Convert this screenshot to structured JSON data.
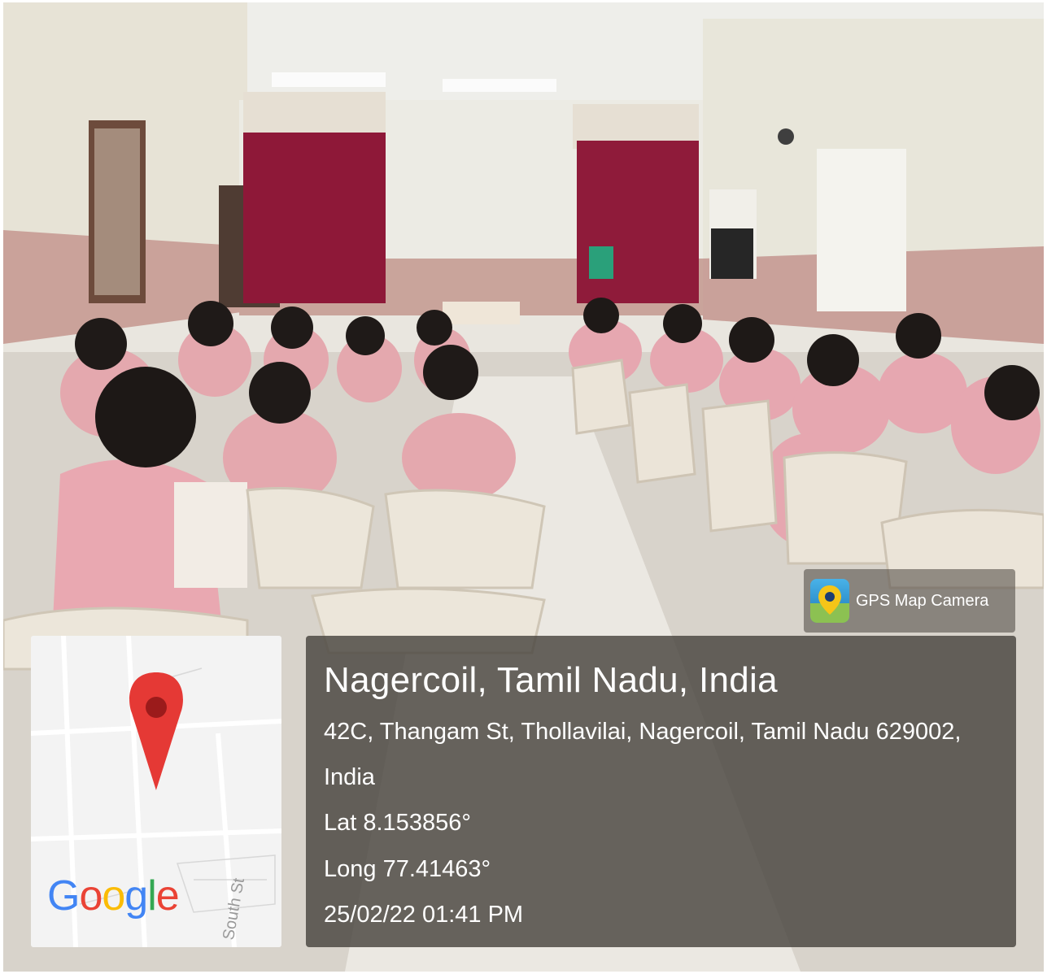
{
  "badge": {
    "icon": "gps-map-camera-app-icon",
    "label": "GPS Map Camera"
  },
  "map": {
    "logo_letters": [
      "G",
      "o",
      "o",
      "g",
      "l",
      "e"
    ],
    "logo_colors": [
      "#4285F4",
      "#EA4335",
      "#FBBC05",
      "#4285F4",
      "#34A853",
      "#EA4335"
    ],
    "street_label": "South St",
    "pin_color": "#E53935"
  },
  "location": {
    "city": "Nagercoil, Tamil Nadu, India",
    "address_line1": "42C, Thangam St, Thollavilai, Nagercoil, Tamil Nadu 629002,",
    "address_line2": "India",
    "latitude": "Lat 8.153856°",
    "longitude": "Long 77.41463°",
    "timestamp": "25/02/22 01:41 PM"
  }
}
